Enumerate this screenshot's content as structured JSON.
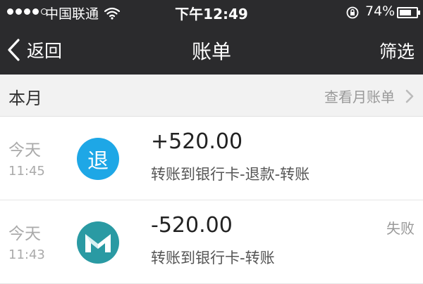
{
  "status_bar": {
    "carrier": "中国联通",
    "time": "下午12:49",
    "battery_percent": "74%",
    "battery_level": 0.74,
    "signal_bars": 4,
    "signal_total": 5
  },
  "nav": {
    "back_label": "返回",
    "title": "账单",
    "filter_label": "筛选"
  },
  "month_bar": {
    "label": "本月",
    "link_label": "查看月账单"
  },
  "transactions": [
    {
      "day": "今天",
      "time": "11:45",
      "icon": "refund-icon",
      "icon_text": "退",
      "amount": "+520.00",
      "description": "转账到银行卡-退款-转账",
      "status": ""
    },
    {
      "day": "今天",
      "time": "11:43",
      "icon": "bank-card-icon",
      "amount": "-520.00",
      "description": "转账到银行卡-转账",
      "status": "失败"
    }
  ],
  "colors": {
    "header_bg": "#2b2b2d",
    "refund_icon": "#1ea7e6",
    "bank_icon": "#2a9aa3"
  }
}
